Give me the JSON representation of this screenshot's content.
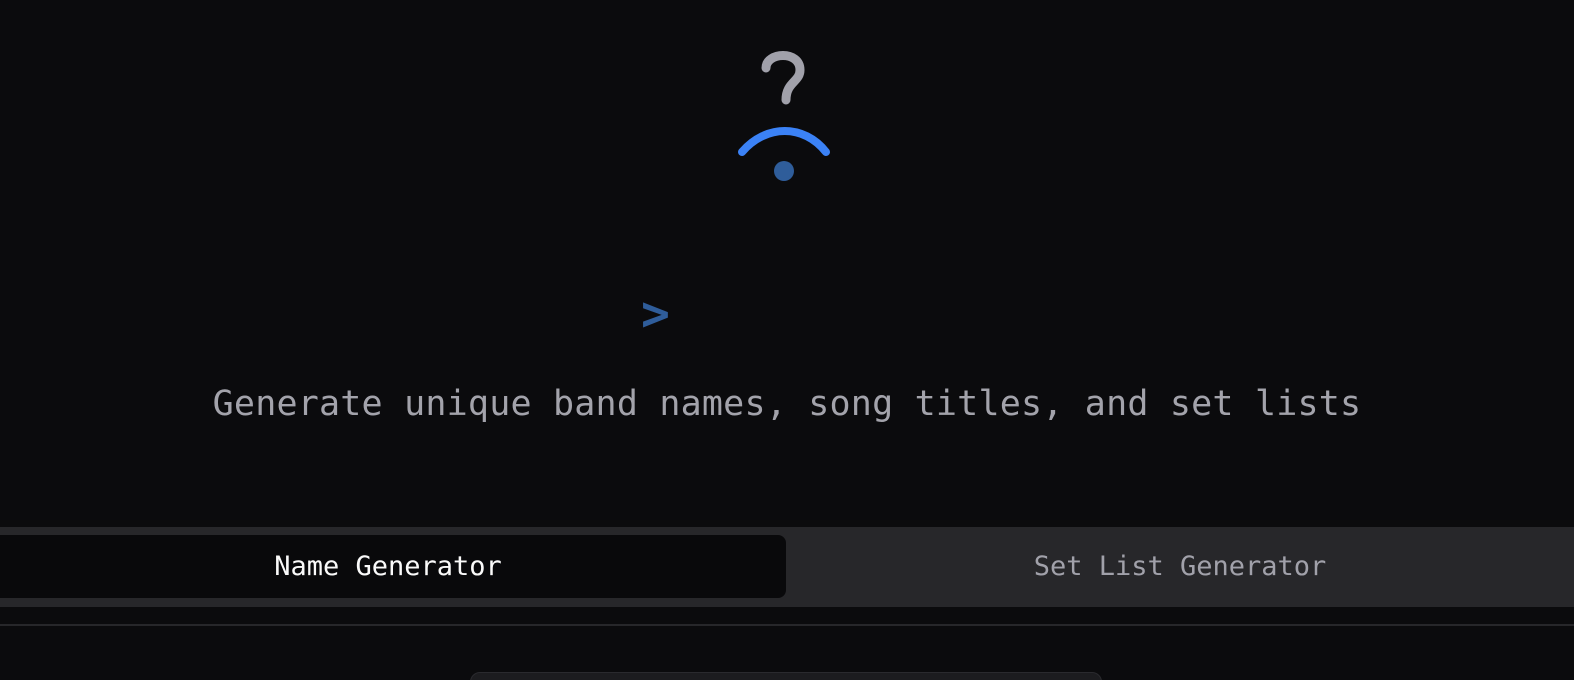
{
  "logo": {
    "icon": "question-broadcast-icon",
    "colors": {
      "question_mark": "#a1a1aa",
      "arc": "#3b82f6",
      "dot": "#2f5d9a"
    }
  },
  "prompt_glyph": ">",
  "tagline": "Generate unique band names, song titles, and set lists",
  "tabs": [
    {
      "label": "Name Generator",
      "active": true
    },
    {
      "label": "Set List Generator",
      "active": false
    }
  ]
}
